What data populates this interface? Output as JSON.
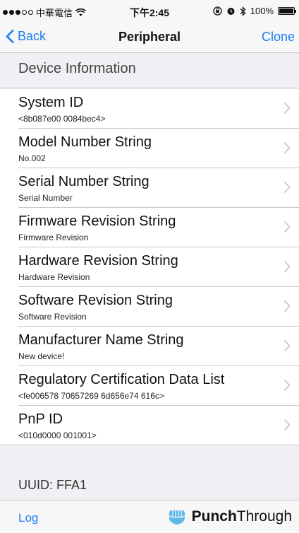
{
  "status_bar": {
    "carrier": "中華電信",
    "time": "下午2:45",
    "battery_text": "100%"
  },
  "nav": {
    "back_label": "Back",
    "title": "Peripheral",
    "clone_label": "Clone"
  },
  "section_header": "Device Information",
  "rows": [
    {
      "title": "System ID",
      "value": "<8b087e00 0084bec4>"
    },
    {
      "title": "Model Number String",
      "value": "No.002"
    },
    {
      "title": "Serial Number String",
      "value": "Serial Number"
    },
    {
      "title": "Firmware Revision String",
      "value": "Firmware Revision"
    },
    {
      "title": "Hardware Revision String",
      "value": "Hardware Revision"
    },
    {
      "title": "Software Revision String",
      "value": "Software Revision"
    },
    {
      "title": "Manufacturer Name String",
      "value": "New device!"
    },
    {
      "title": "Regulatory Certification Data List",
      "value": "<fe006578 70657269 6d656e74 616c>"
    },
    {
      "title": "PnP ID",
      "value": "<010d0000 001001>"
    }
  ],
  "uuid_label": "UUID: FFA1",
  "toolbar": {
    "log_label": "Log",
    "brand_bold": "Punch",
    "brand_light": "Through"
  },
  "colors": {
    "accent": "#1a7cf5",
    "background": "#f0f0f4"
  },
  "icons": [
    "signal-dots-icon",
    "wifi-icon",
    "lock-rotation-icon",
    "alarm-icon",
    "bluetooth-icon",
    "battery-icon",
    "chevron-left-icon",
    "chevron-right-icon",
    "punchthrough-logo-icon"
  ]
}
